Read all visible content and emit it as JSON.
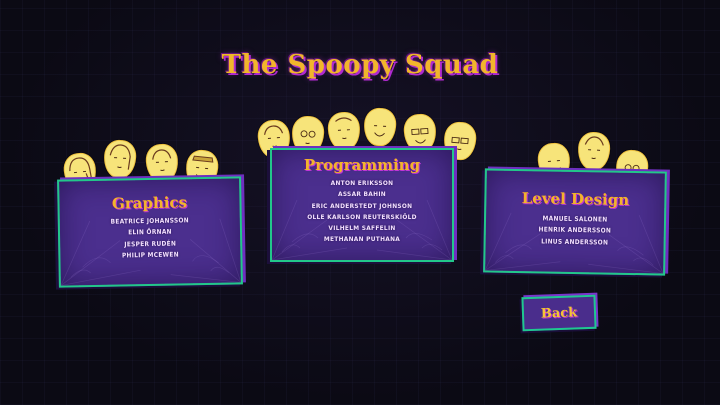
{
  "title": "The Spoopy Squad",
  "sections": [
    {
      "heading": "Graphics",
      "names": [
        "Beatrice Johansson",
        "Elin Örnan",
        "Jesper Rudén",
        "Philip McEwen"
      ]
    },
    {
      "heading": "Programming",
      "names": [
        "Anton Eriksson",
        "Assar Bahin",
        "Eric Anderstedt Johnson",
        "Olle Karlson Reuterskiöld",
        "Vilhelm Saffelin",
        "Methanan Puthana"
      ]
    },
    {
      "heading": "Level Design",
      "names": [
        "Manuel Salonen",
        "Henrik Andersson",
        "Linus Andersson"
      ]
    }
  ],
  "back_label": "Back",
  "colors": {
    "accent_gold": "#f1b52b",
    "panel_purple": "#4b2f8e",
    "panel_border_green": "#22c78a",
    "shadow_magenta": "#c035d8",
    "face_yellow": "#f7e47a"
  }
}
